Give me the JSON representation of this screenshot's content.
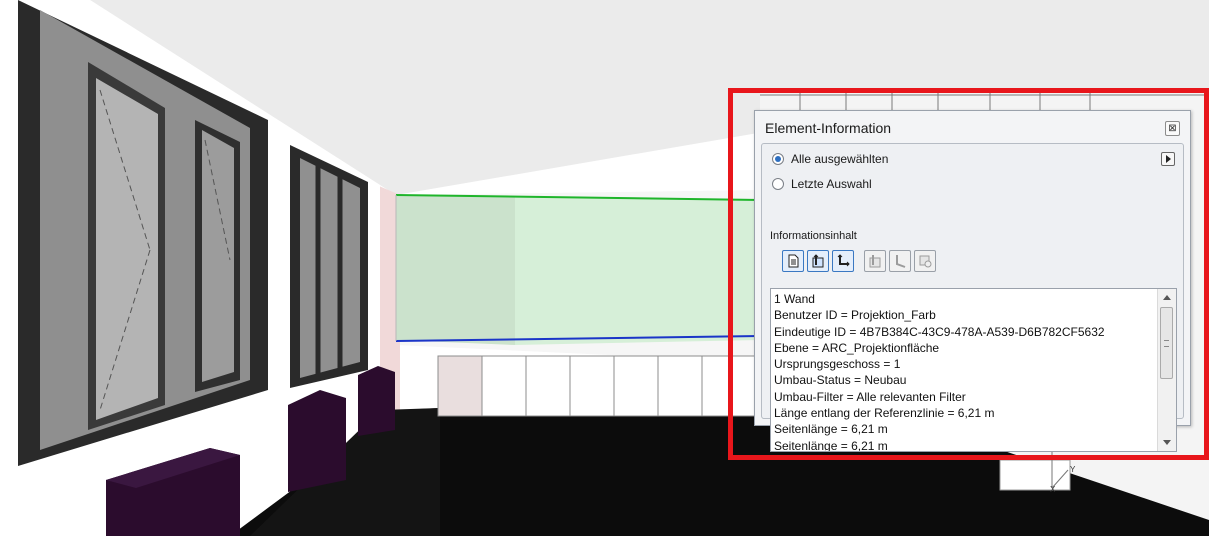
{
  "panel": {
    "title": "Element-Information",
    "close_glyph": "⊠",
    "radio_all_label": "Alle ausgewählten",
    "radio_last_label": "Letzte Auswahl",
    "section_label": "Informationsinhalt",
    "info_lines": [
      "1 Wand",
      "Benutzer ID = Projektion_Farb",
      "Eindeutige ID = 4B7B384C-43C9-478A-A539-D6B782CF5632",
      "Ebene = ARC_Projektionfläche",
      "Ursprungsgeschoss = 1",
      "Umbau-Status = Neubau",
      "Umbau-Filter = Alle relevanten Filter",
      "Länge entlang der Referenzlinie = 6,21 m",
      "Seitenlänge = 6,21 m",
      "Seitenlänge = 6,21 m"
    ]
  },
  "scene": {
    "axis_y_label": "Y",
    "axis_x_label": "X"
  },
  "colors": {
    "highlight": "#e8161b",
    "projection_fill": "#cfe9d1",
    "selection_green": "#1fb52b",
    "selection_blue": "#1b35c8",
    "floor": "#0c0c0c",
    "radiator": "#2b0c2d",
    "window_frame": "#2a2a2a"
  },
  "icons": [
    "document-icon",
    "element-info-icon",
    "axis-info-icon",
    "element-info-dim-icon",
    "axis-dim-icon",
    "settings-dim-icon"
  ]
}
